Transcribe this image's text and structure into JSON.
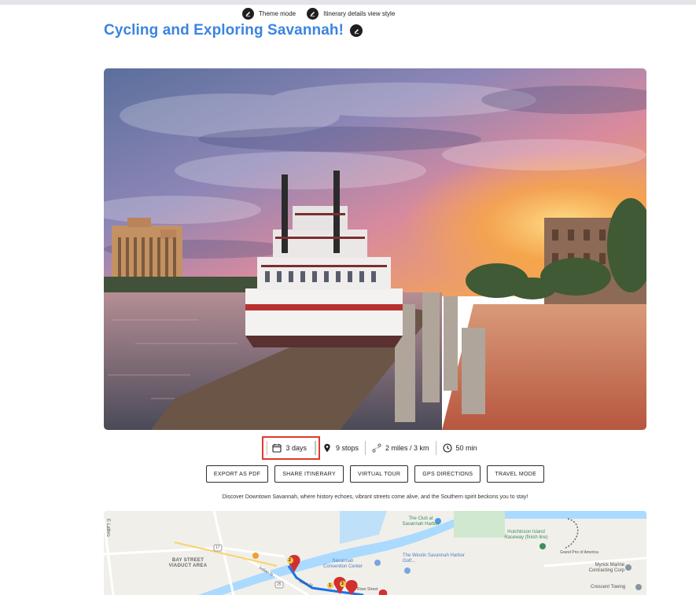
{
  "header": {
    "theme_mode_label": "Theme mode",
    "view_style_label": "Itinerary details view style"
  },
  "page": {
    "title": "Cycling and Exploring Savannah!"
  },
  "stats": {
    "duration": "3 days",
    "stops": "9 stops",
    "distance": "2 miles / 3 km",
    "time": "50 min"
  },
  "actions": {
    "export_pdf": "EXPORT AS PDF",
    "share": "SHARE ITINERARY",
    "virtual_tour": "VIRTUAL TOUR",
    "gps": "GPS DIRECTIONS",
    "travel_mode": "TRAVEL MODE"
  },
  "description": "Discover Downtown Savannah, where history echoes, vibrant streets come alive, and the Southern spirit beckons you to stay!",
  "map": {
    "labels": {
      "club": "The Club at Savannah Harbor",
      "hutchinson": "Hutchinson Island Raceway (finish line)",
      "grand_prix": "Grand Prix of America",
      "bay_street": "BAY STREET VIADUCT AREA",
      "convention": "Savannah Convention Center",
      "westin": "The Westin Savannah Harbor Golf...",
      "myrick": "Myrick Marine Contracting Corp",
      "crescent": "Crescent Towing",
      "river_st": "River St",
      "river_street": "River Street",
      "indian_st": "Indian St",
      "e_lathrop": "E Lathro",
      "route_17": "17",
      "route_25": "25"
    },
    "markers": [
      "1",
      "2",
      "3"
    ]
  },
  "colors": {
    "title": "#3b84e0",
    "highlight": "#e03a2b",
    "marker": "#d32f2f",
    "route": "#1a73e8",
    "water": "#aadaff"
  }
}
